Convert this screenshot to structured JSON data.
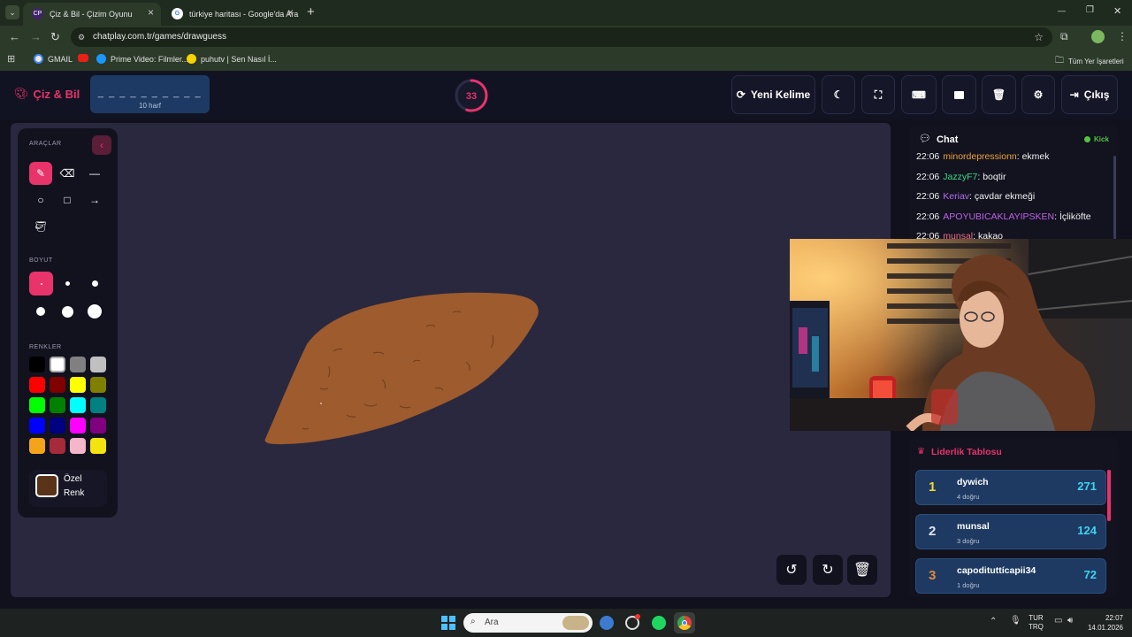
{
  "browser": {
    "tabs": [
      {
        "favicon": "CP",
        "title": "Çiz & Bil - Çizim Oyunu",
        "active": true
      },
      {
        "favicon": "G",
        "title": "türkiye haritası - Google'da Ara",
        "active": false
      }
    ],
    "new_tab": "+",
    "url": "chatplay.com.tr/games/drawguess",
    "bookmarks": [
      "GMAIL",
      "Prime Video: Filmler...",
      "puhutv | Sen Nasıl İ..."
    ],
    "all_bookmarks": "Tüm Yer İşaretleri",
    "window_controls": [
      "—",
      "❐",
      "✕"
    ]
  },
  "header": {
    "logo": "Çiz & Bil",
    "word_blanks": "_ _ _ _ _ _ _ _ _ _",
    "word_hint": "10 harf",
    "timer": "33",
    "timer_progress": 0.55,
    "new_word": "Yeni Kelime",
    "exit": "Çıkış"
  },
  "tools": {
    "tools_title": "ARAÇLAR",
    "size_title": "BOYUT",
    "colors_title": "RENKLER",
    "custom_color_label": "Özel\nRenk",
    "custom_color": "#5a3418",
    "palette": [
      "#000000",
      "#ffffff",
      "#808080",
      "#c0c0c0",
      "#ff0000",
      "#800000",
      "#ffff00",
      "#808000",
      "#00ff00",
      "#008000",
      "#00ffff",
      "#008080",
      "#0000ff",
      "#000080",
      "#ff00ff",
      "#800080",
      "#f5a31a",
      "#a52a3a",
      "#f4b6c8",
      "#f3e40f"
    ]
  },
  "chat": {
    "title": "Chat",
    "platform": "Kick",
    "messages": [
      {
        "time": "22:06",
        "user": "minordepressionn",
        "color": "#f0a33a",
        "text": "ekmek"
      },
      {
        "time": "22:06",
        "user": "JazzyF7",
        "color": "#3ddc8a",
        "text": "boqtir"
      },
      {
        "time": "22:06",
        "user": "Keriav",
        "color": "#b36cf0",
        "text": "çavdar ekmeği"
      },
      {
        "time": "22:06",
        "user": "APOYUBICAKLAYIPSKEN",
        "color": "#c060e8",
        "text": "İçliköfte"
      },
      {
        "time": "22:06",
        "user": "munsal",
        "color": "#ef6a8a",
        "text": "kakao"
      }
    ]
  },
  "leaderboard": {
    "title": "Liderlik Tablosu",
    "rows": [
      {
        "rank": "1",
        "rank_color": "#f5d531",
        "name": "dywich",
        "sub": "4 doğru",
        "points": "271"
      },
      {
        "rank": "2",
        "rank_color": "#dfe6f2",
        "name": "munsal",
        "sub": "3 doğru",
        "points": "124"
      },
      {
        "rank": "3",
        "rank_color": "#e2893a",
        "name": "capodituttícapii34",
        "sub": "1 doğru",
        "points": "72"
      }
    ]
  },
  "taskbar": {
    "search": "Ara",
    "lang_top": "TUR",
    "lang_bottom": "TRQ",
    "time": "22:07",
    "date": "14.01.2026"
  },
  "colors": {
    "accent": "#e8336b",
    "canvas": "#29283e",
    "drawing": "#9d5b2e"
  }
}
